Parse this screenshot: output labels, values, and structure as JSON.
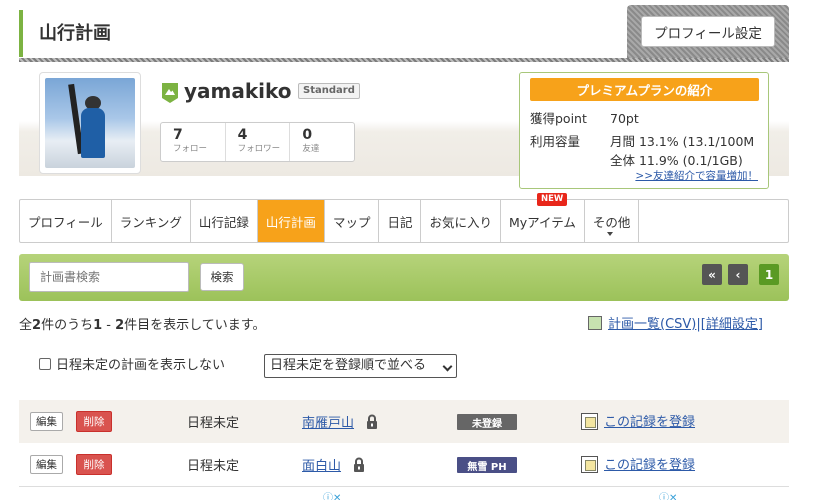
{
  "header": {
    "title": "山行計画",
    "profile_settings_label": "プロフィール設定"
  },
  "profile": {
    "username": "yamakiko",
    "plan_badge": "Standard",
    "stats": [
      {
        "count": "7",
        "label": "フォロー"
      },
      {
        "count": "4",
        "label": "フォロワー"
      },
      {
        "count": "0",
        "label": "友達"
      }
    ]
  },
  "premium": {
    "header": "プレミアムプランの紹介",
    "points_label": "獲得point",
    "points_value": "70pt",
    "storage_label": "利用容量",
    "monthly": "月間 13.1% (13.1/100M",
    "total": "全体 11.9% (0.1/1GB)",
    "link": ">>友達紹介で容量増加！"
  },
  "tabs": [
    {
      "label": "プロフィール",
      "active": false
    },
    {
      "label": "ランキング",
      "active": false
    },
    {
      "label": "山行記録",
      "active": false
    },
    {
      "label": "山行計画",
      "active": true
    },
    {
      "label": "マップ",
      "active": false
    },
    {
      "label": "日記",
      "active": false
    },
    {
      "label": "お気に入り",
      "active": false
    },
    {
      "label": "Myアイテム",
      "active": false,
      "badge": "NEW"
    },
    {
      "label": "その他",
      "active": false
    }
  ],
  "search": {
    "placeholder": "計画書検索",
    "button": "検索"
  },
  "pager": {
    "first": "«",
    "prev": "‹",
    "current": "1"
  },
  "results": {
    "prefix": "全",
    "total": "2",
    "mid1": "件のうち",
    "from": "1",
    "dash": " - ",
    "to": "2",
    "suffix": "件目を表示しています。",
    "csv_link": "計画一覧(CSV)",
    "separator": "|",
    "detail_link": "[詳細設定]"
  },
  "filter": {
    "hide_undated_label": "日程未定の計画を表示しない",
    "hide_undated_checked": false,
    "sort_value": "日程未定を登録順で並べる"
  },
  "rows": [
    {
      "edit": "編集",
      "delete": "削除",
      "date": "日程未定",
      "mountain": "南雁戸山",
      "status": "未登録",
      "register": "この記録を登録"
    },
    {
      "edit": "編集",
      "delete": "削除",
      "date": "日程未定",
      "mountain": "面白山",
      "status": "無雪 PH",
      "register": "この記録を登録"
    }
  ],
  "colors": {
    "accent_orange": "#f7a21a",
    "accent_green": "#7cb342",
    "link_blue": "#2d5aa8",
    "delete_red": "#d9534f"
  }
}
